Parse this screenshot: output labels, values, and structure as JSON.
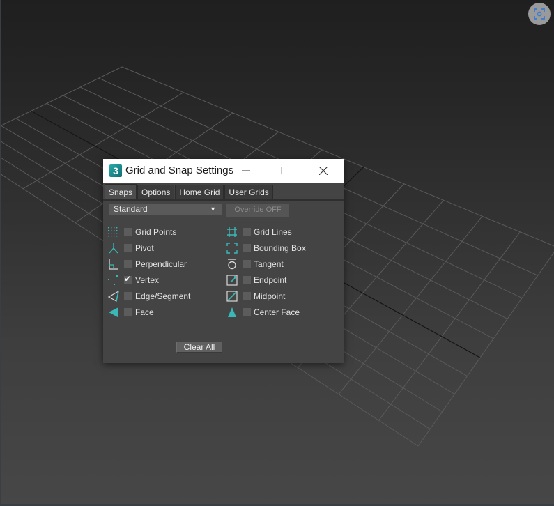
{
  "viewport": {
    "name": "perspective-viewport",
    "grid_color": "#5a5a5a",
    "axis_color": "#141414",
    "top_right_button": {
      "icon": "viewport-focus-icon",
      "color": "#3a7bd5"
    }
  },
  "dialog": {
    "title": "Grid and Snap Settings",
    "app_icon": {
      "icon": "3dsmax-app-icon",
      "glyph": "3"
    },
    "window_controls": {
      "minimize": {
        "icon": "minimize-icon",
        "glyph": "—"
      },
      "maximize": {
        "icon": "maximize-icon",
        "glyph": "☐"
      },
      "close": {
        "icon": "close-icon",
        "glyph": "✕"
      }
    },
    "tabs": [
      {
        "label": "Snaps",
        "active": true
      },
      {
        "label": "Options",
        "active": false
      },
      {
        "label": "Home Grid",
        "active": false
      },
      {
        "label": "User Grids",
        "active": false
      }
    ],
    "snap_type_dropdown": {
      "selected": "Standard",
      "arrow": "▼"
    },
    "override_button": {
      "label": "Override OFF",
      "enabled": false
    },
    "accent_color": "#3ab8b8",
    "snaps_left": [
      {
        "label": "Grid Points",
        "icon": "grid-points-icon",
        "checked": false
      },
      {
        "label": "Pivot",
        "icon": "pivot-icon",
        "checked": false
      },
      {
        "label": "Perpendicular",
        "icon": "perpendicular-icon",
        "checked": false
      },
      {
        "label": "Vertex",
        "icon": "vertex-icon",
        "checked": true
      },
      {
        "label": "Edge/Segment",
        "icon": "edge-segment-icon",
        "checked": false
      },
      {
        "label": "Face",
        "icon": "face-icon",
        "checked": false
      }
    ],
    "snaps_right": [
      {
        "label": "Grid Lines",
        "icon": "grid-lines-icon",
        "checked": false
      },
      {
        "label": "Bounding Box",
        "icon": "bounding-box-icon",
        "checked": false
      },
      {
        "label": "Tangent",
        "icon": "tangent-icon",
        "checked": false
      },
      {
        "label": "Endpoint",
        "icon": "endpoint-icon",
        "checked": false
      },
      {
        "label": "Midpoint",
        "icon": "midpoint-icon",
        "checked": false
      },
      {
        "label": "Center Face",
        "icon": "center-face-icon",
        "checked": false
      }
    ],
    "check_glyph": "✔",
    "clear_all_label": "Clear All"
  }
}
